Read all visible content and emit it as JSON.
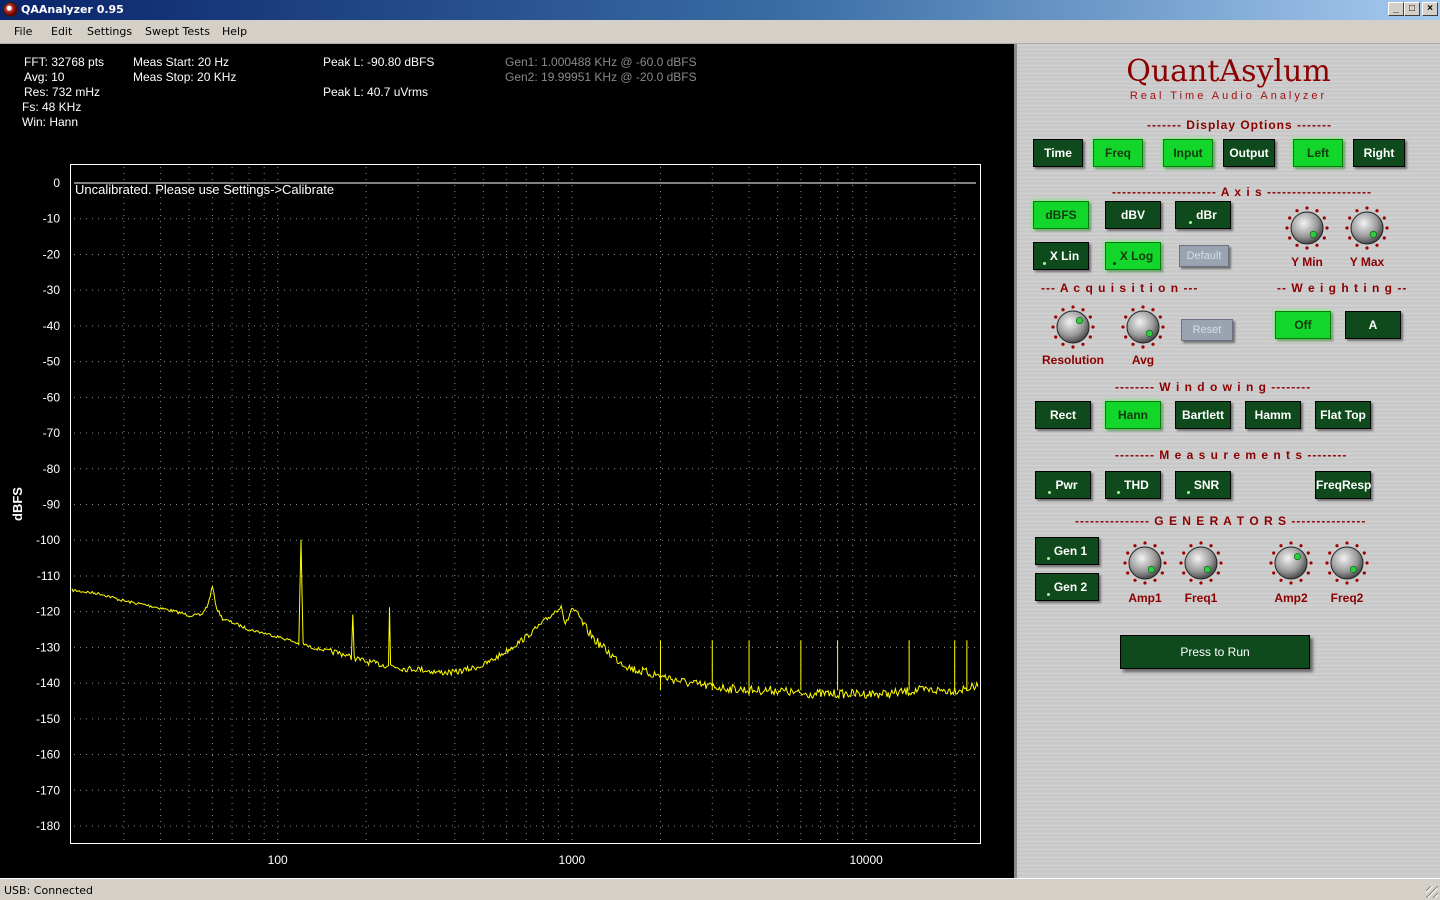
{
  "window": {
    "title": "QAAnalyzer 0.95",
    "minimize": "_",
    "maximize": "□",
    "close": "×"
  },
  "menu": [
    "File",
    "Edit",
    "Settings",
    "Swept Tests",
    "Help"
  ],
  "info": {
    "col1": [
      "FFT: 32768 pts",
      "Avg: 10",
      "Res: 732 mHz",
      "Fs: 48 KHz",
      "Win: Hann"
    ],
    "col2": [
      "Meas Start: 20 Hz",
      "Meas Stop: 20 KHz"
    ],
    "peak_dbfs": "Peak L: -90.80 dBFS",
    "peak_vrms": "Peak L: 40.7 uVrms",
    "gen1": "Gen1: 1.000488 KHz @ -60.0 dBFS",
    "gen2": "Gen2: 19.99951 KHz @ -20.0 dBFS"
  },
  "chart_data": {
    "type": "line",
    "annotation": "Uncalibrated. Please use Settings->Calibrate",
    "ylabel": "dBFS",
    "xlabel": "",
    "xscale": "log",
    "xlim": [
      20,
      24000
    ],
    "ylim": [
      -185,
      0
    ],
    "yticks": [
      0,
      -10,
      -20,
      -30,
      -40,
      -50,
      -60,
      -70,
      -80,
      -90,
      -100,
      -110,
      -120,
      -130,
      -140,
      -150,
      -160,
      -170,
      -180
    ],
    "xticks": [
      100,
      1000,
      10000
    ],
    "grid": true,
    "series": [
      {
        "color": "#ffff00",
        "x": [
          20,
          25,
          30,
          35,
          40,
          45,
          50,
          55,
          58,
          60,
          62,
          65,
          70,
          80,
          90,
          100,
          110,
          118,
          120,
          122,
          130,
          150,
          170,
          178,
          180,
          182,
          200,
          230,
          238,
          240,
          242,
          270,
          300,
          350,
          400,
          450,
          500,
          550,
          600,
          650,
          700,
          750,
          800,
          850,
          900,
          920,
          950,
          1000,
          1050,
          1100,
          1200,
          1400,
          1600,
          2000,
          2500,
          3000,
          4000,
          5000,
          6000,
          8000,
          10000,
          12000,
          15000,
          18000,
          20000,
          24000
        ],
        "y": [
          -114,
          -115,
          -117,
          -118,
          -119,
          -120,
          -121,
          -121,
          -118,
          -113,
          -119,
          -122,
          -123,
          -125,
          -126,
          -127,
          -128,
          -129,
          -100,
          -129,
          -130,
          -131,
          -132,
          -133,
          -120,
          -133,
          -134,
          -135,
          -135,
          -119,
          -135,
          -136,
          -136,
          -137,
          -137,
          -136,
          -135,
          -133,
          -131,
          -129,
          -127,
          -125,
          -123,
          -121,
          -119,
          -118,
          -124,
          -119,
          -121,
          -124,
          -128,
          -133,
          -136,
          -138,
          -140,
          -141,
          -142,
          -142,
          -143,
          -143,
          -143,
          -143,
          -142,
          -142,
          -142,
          -141
        ]
      }
    ]
  },
  "panel": {
    "brand": "QuantAsylum",
    "subtitle": "Real Time Audio Analyzer",
    "display_title": "------- Display Options -------",
    "display_buttons": [
      {
        "label": "Time",
        "on": false
      },
      {
        "label": "Freq",
        "on": true
      },
      {
        "label": "Input",
        "on": true
      },
      {
        "label": "Output",
        "on": false
      },
      {
        "label": "Left",
        "on": true
      },
      {
        "label": "Right",
        "on": false
      }
    ],
    "axis_title": "--------------------- A x i s ---------------------",
    "axis_buttons": [
      {
        "label": "dBFS",
        "on": true
      },
      {
        "label": "dBV",
        "on": false
      },
      {
        "label": "dBr",
        "on": false
      },
      {
        "label": "X Lin",
        "on": false
      },
      {
        "label": "X Log",
        "on": true
      },
      {
        "label": "Default",
        "on": false
      }
    ],
    "ymin_label": "Y Min",
    "ymax_label": "Y Max",
    "acq_title": "--- A c q u i s i t i o n ---",
    "resolution_label": "Resolution",
    "avg_label": "Avg",
    "reset_label": "Reset",
    "weight_title": "-- W e i g h t i n g --",
    "weight_buttons": [
      {
        "label": "Off",
        "on": true
      },
      {
        "label": "A",
        "on": false
      }
    ],
    "window_title": "-------- W i n d o w i n g --------",
    "window_buttons": [
      {
        "label": "Rect",
        "on": false
      },
      {
        "label": "Hann",
        "on": true
      },
      {
        "label": "Bartlett",
        "on": false
      },
      {
        "label": "Hamm",
        "on": false
      },
      {
        "label": "Flat Top",
        "on": false
      }
    ],
    "meas_title": "-------- M e a s u r e m e n t s --------",
    "meas_buttons": [
      {
        "label": "Pwr",
        "on": false
      },
      {
        "label": "THD",
        "on": false
      },
      {
        "label": "SNR",
        "on": false
      },
      {
        "label": "FreqResp",
        "on": false
      }
    ],
    "gen_title": "--------------- G E N E R A T O R S ---------------",
    "gen_buttons": [
      {
        "label": "Gen 1",
        "on": false
      },
      {
        "label": "Gen 2",
        "on": false
      }
    ],
    "amp1_label": "Amp1",
    "freq1_label": "Freq1",
    "amp2_label": "Amp2",
    "freq2_label": "Freq2",
    "run_label": "Press to Run"
  },
  "status": "USB: Connected"
}
